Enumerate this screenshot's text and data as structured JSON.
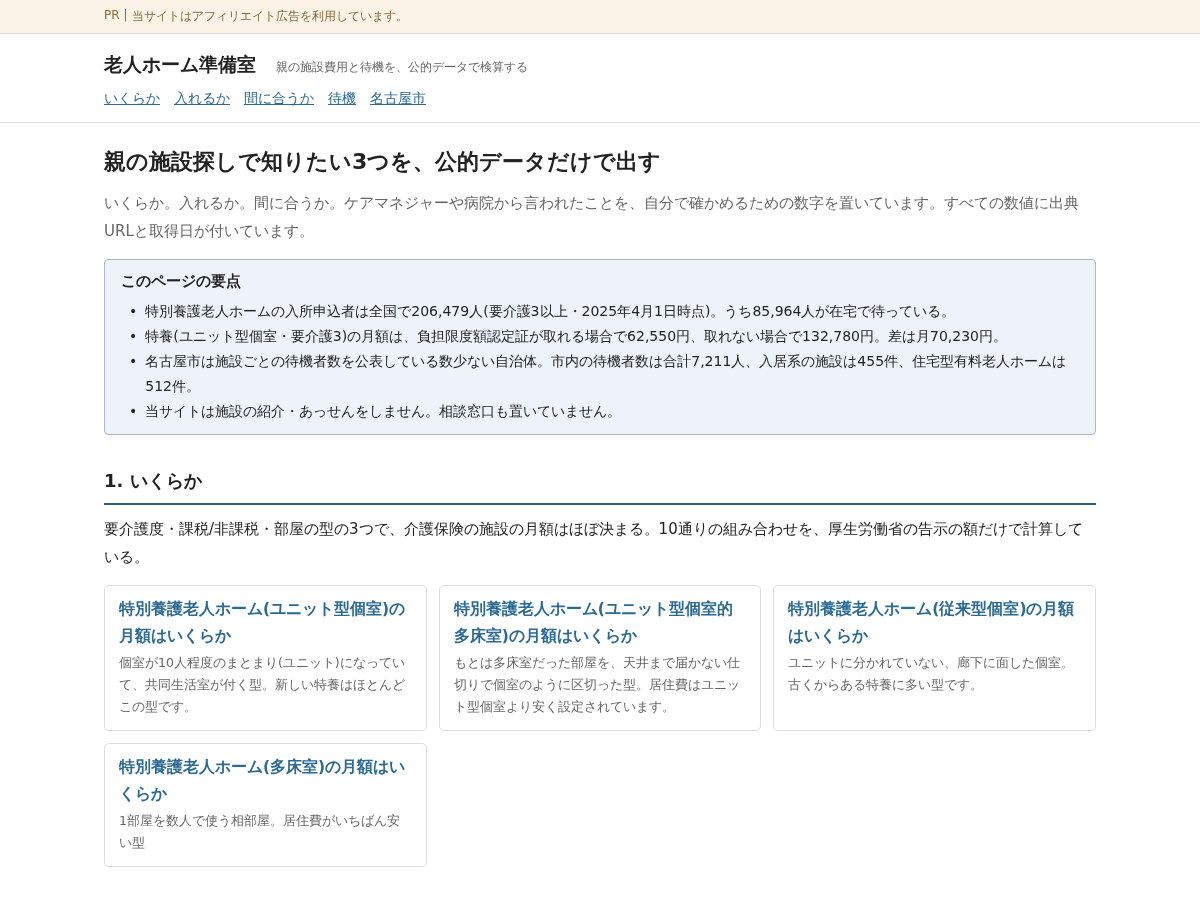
{
  "pr_bar": {
    "label": "PR",
    "separator": "|",
    "text": "当サイトはアフィリエイト広告を利用しています。"
  },
  "header": {
    "site_title": "老人ホーム準備室",
    "tagline": "親の施設費用と待機を、公的データで検算する",
    "nav": [
      "いくらか",
      "入れるか",
      "間に合うか",
      "待機",
      "名古屋市"
    ]
  },
  "hero": {
    "heading": "親の施設探しで知りたい3つを、公的データだけで出す",
    "lead": "いくらか。入れるか。間に合うか。ケアマネジャーや病院から言われたことを、自分で確かめるための数字を置いています。すべての数値に出典URLと取得日が付いています。"
  },
  "summary": {
    "title": "このページの要点",
    "marker": "•",
    "points": [
      "特別養護老人ホームの入所申込者は全国で206,479人(要介護3以上・2025年4月1日時点)。うち85,964人が在宅で待っている。",
      "特養(ユニット型個室・要介護3)の月額は、負担限度額認定証が取れる場合で62,550円、取れない場合で132,780円。差は月70,230円。",
      "名古屋市は施設ごとの待機者数を公表している数少ない自治体。市内の待機者数は合計7,211人、入居系の施設は455件、住宅型有料老人ホームは512件。",
      "当サイトは施設の紹介・あっせんをしません。相談窓口も置いていません。"
    ]
  },
  "section": {
    "heading": "1. いくらか",
    "intro": "要介護度・課税/非課税・部屋の型の3つで、介護保険の施設の月額はほぼ決まる。10通りの組み合わせを、厚生労働省の告示の額だけで計算している。",
    "cards": [
      {
        "title": "特別養護老人ホーム(ユニット型個室)の月額はいくらか",
        "text": "個室が10人程度のまとまり(ユニット)になっていて、共同生活室が付く型。新しい特養はほとんどこの型です。"
      },
      {
        "title": "特別養護老人ホーム(ユニット型個室的多床室)の月額はいくらか",
        "text": "もとは多床室だった部屋を、天井まで届かない仕切りで個室のように区切った型。居住費はユニット型個室より安く設定されています。"
      },
      {
        "title": "特別養護老人ホーム(従来型個室)の月額はいくらか",
        "text": "ユニットに分かれていない、廊下に面した個室。古くからある特養に多い型です。"
      },
      {
        "title": "特別養護老人ホーム(多床室)の月額はいくらか",
        "text": "1部屋を数人で使う相部屋。居住費がいちばん安い型"
      }
    ]
  }
}
